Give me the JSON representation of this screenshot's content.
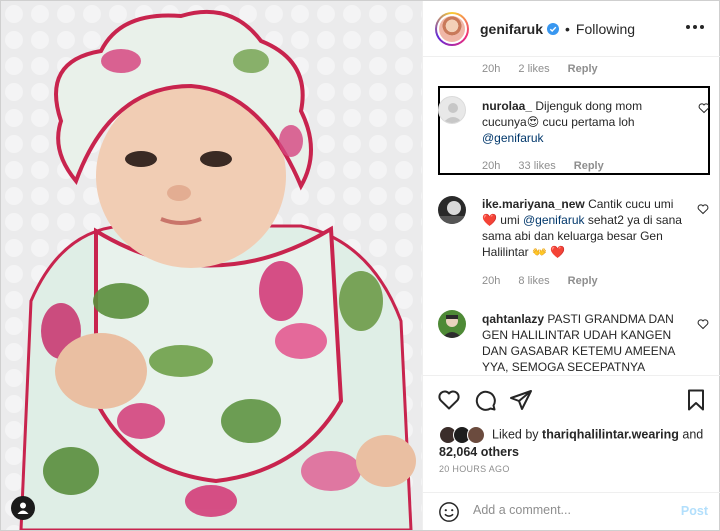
{
  "header": {
    "username": "genifaruk",
    "separator": "•",
    "follow_status": "Following"
  },
  "comments": [
    {
      "time": "20h",
      "likes": "2 likes",
      "reply": "Reply"
    },
    {
      "username": "nurolaa_",
      "text": "Dijenguk dong mom cucunya😍 cucu pertama loh",
      "mention": "@genifaruk",
      "time": "20h",
      "likes": "33 likes",
      "reply": "Reply"
    },
    {
      "username": "ike.mariyana_new",
      "text_a": "Cantik cucu umi ❤️ umi",
      "mention": "@genifaruk",
      "text_b": "sehat2 ya di sana sama abi dan keluarga besar Gen Halilintar 👐 ❤️",
      "time": "20h",
      "likes": "8 likes",
      "reply": "Reply"
    },
    {
      "username": "qahtanlazy",
      "text": "PASTI GRANDMA DAN GEN HALILINTAR UDAH KANGEN DAN GASABAR KETEMU AMEENA YYA, SEMOGA SECEPATNYA"
    }
  ],
  "likes": {
    "prefix": "Liked by",
    "user": "thariqhalilintar.wearing",
    "middle": "and",
    "count": "82,064 others"
  },
  "timestamp": "20 HOURS AGO",
  "add_comment": {
    "placeholder": "Add a comment...",
    "post_label": "Post"
  },
  "colors": {
    "accent_red": "#ed4956",
    "mention_blue": "#00376b",
    "muted": "#8e8e8e",
    "post_disabled": "#b2dffc"
  },
  "icons": [
    "user-tag-icon",
    "verified-icon",
    "more-icon",
    "heart-icon",
    "comment-icon",
    "share-icon",
    "bookmark-icon",
    "emoji-icon"
  ]
}
